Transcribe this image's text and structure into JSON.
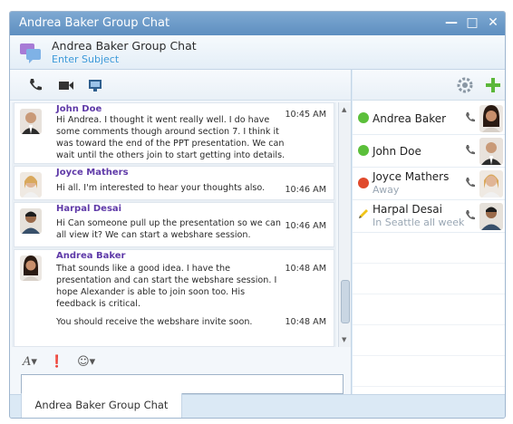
{
  "window": {
    "title": "Andrea Baker Group Chat",
    "controls": [
      "minimize",
      "maximize",
      "close"
    ]
  },
  "conversation": {
    "title": "Andrea Baker Group Chat",
    "subject_placeholder": "Enter Subject"
  },
  "toolbar": {
    "icons": [
      "phone-icon",
      "video-icon",
      "present-icon"
    ]
  },
  "messages": [
    {
      "sender": "John Doe",
      "lines": [
        "Hi Andrea. I thought it went really well. I do have",
        "some comments though around section 7. I think it",
        "was toward the end of the PPT presentation. We can",
        "wait until the others join to start getting into details."
      ],
      "time": "10:45 AM"
    },
    {
      "sender": "Joyce Mathers",
      "lines": [
        "Hi all. I'm interested to hear your thoughts also."
      ],
      "time": "10:46 AM"
    },
    {
      "sender": "Harpal Desai",
      "lines": [
        "Hi Can someone pull up the presentation so we can",
        "all view it? We can start a webshare session."
      ],
      "time": "10:46 AM"
    },
    {
      "sender": "Andrea Baker",
      "lines": [
        "That sounds like a good idea. I have the",
        "presentation and can start the webshare session. I",
        "hope Alexander is able to join soon too. His",
        "feedback is critical."
      ],
      "time": "10:48 AM",
      "followup": {
        "text": "You should receive the webshare invite soon.",
        "time": "10:48 AM"
      }
    }
  ],
  "participants": [
    {
      "name": "Andrea Baker",
      "status": "available",
      "status_color": "#5bbf3a",
      "note": ""
    },
    {
      "name": "John Doe",
      "status": "available",
      "status_color": "#5bbf3a",
      "note": ""
    },
    {
      "name": "Joyce Mathers",
      "status": "away",
      "status_color": "#e04a2c",
      "note": "Away"
    },
    {
      "name": "Harpal Desai",
      "status": "note",
      "status_color": "#f0c419",
      "note": "In Seattle all week"
    }
  ],
  "tabs": [
    {
      "label": "Andrea Baker Group Chat"
    }
  ],
  "colors": {
    "titlebar": "#6a99c7",
    "sender": "#5f3aa8",
    "subject": "#3d9ad9",
    "add_green": "#5bb73a"
  }
}
